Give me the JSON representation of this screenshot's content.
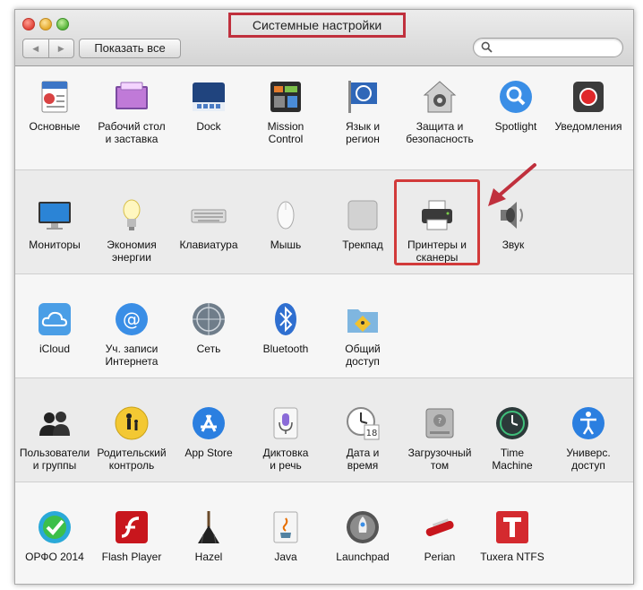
{
  "window": {
    "title": "Системные настройки",
    "show_all": "Показать все",
    "search_placeholder": "",
    "accent_highlight": "#c0303d"
  },
  "sections": [
    {
      "items": [
        {
          "label": "Основные",
          "icon": "general-icon"
        },
        {
          "label": "Рабочий стол\nи заставка",
          "icon": "desktop-icon"
        },
        {
          "label": "Dock",
          "icon": "dock-icon"
        },
        {
          "label": "Mission\nControl",
          "icon": "mission-control-icon"
        },
        {
          "label": "Язык и\nрегион",
          "icon": "language-icon"
        },
        {
          "label": "Защита и\nбезопасность",
          "icon": "security-icon"
        },
        {
          "label": "Spotlight",
          "icon": "spotlight-icon"
        },
        {
          "label": "Уведомления",
          "icon": "notifications-icon"
        }
      ]
    },
    {
      "items": [
        {
          "label": "Мониторы",
          "icon": "displays-icon"
        },
        {
          "label": "Экономия\nэнергии",
          "icon": "energy-saver-icon"
        },
        {
          "label": "Клавиатура",
          "icon": "keyboard-icon"
        },
        {
          "label": "Мышь",
          "icon": "mouse-icon"
        },
        {
          "label": "Трекпад",
          "icon": "trackpad-icon"
        },
        {
          "label": "Принтеры и\nсканеры",
          "icon": "printer-icon",
          "highlighted": true
        },
        {
          "label": "Звук",
          "icon": "sound-icon"
        }
      ]
    },
    {
      "items": [
        {
          "label": "iCloud",
          "icon": "icloud-icon"
        },
        {
          "label": "Уч. записи\nИнтернета",
          "icon": "internet-accounts-icon"
        },
        {
          "label": "Сеть",
          "icon": "network-icon"
        },
        {
          "label": "Bluetooth",
          "icon": "bluetooth-icon"
        },
        {
          "label": "Общий\nдоступ",
          "icon": "sharing-icon"
        }
      ]
    },
    {
      "items": [
        {
          "label": "Пользователи\nи группы",
          "icon": "users-icon"
        },
        {
          "label": "Родительский\nконтроль",
          "icon": "parental-controls-icon"
        },
        {
          "label": "App Store",
          "icon": "app-store-icon"
        },
        {
          "label": "Диктовка\nи речь",
          "icon": "dictation-icon"
        },
        {
          "label": "Дата и\nвремя",
          "icon": "date-time-icon"
        },
        {
          "label": "Загрузочный\nтом",
          "icon": "startup-disk-icon"
        },
        {
          "label": "Time\nMachine",
          "icon": "time-machine-icon"
        },
        {
          "label": "Универс.\nдоступ",
          "icon": "accessibility-icon"
        }
      ]
    },
    {
      "items": [
        {
          "label": "ОРФО 2014",
          "icon": "orfo-icon"
        },
        {
          "label": "Flash Player",
          "icon": "flash-icon"
        },
        {
          "label": "Hazel",
          "icon": "hazel-icon"
        },
        {
          "label": "Java",
          "icon": "java-icon"
        },
        {
          "label": "Launchpad",
          "icon": "launchpad-icon"
        },
        {
          "label": "Perian",
          "icon": "perian-icon"
        },
        {
          "label": "Tuxera NTFS",
          "icon": "tuxera-icon"
        }
      ]
    }
  ]
}
